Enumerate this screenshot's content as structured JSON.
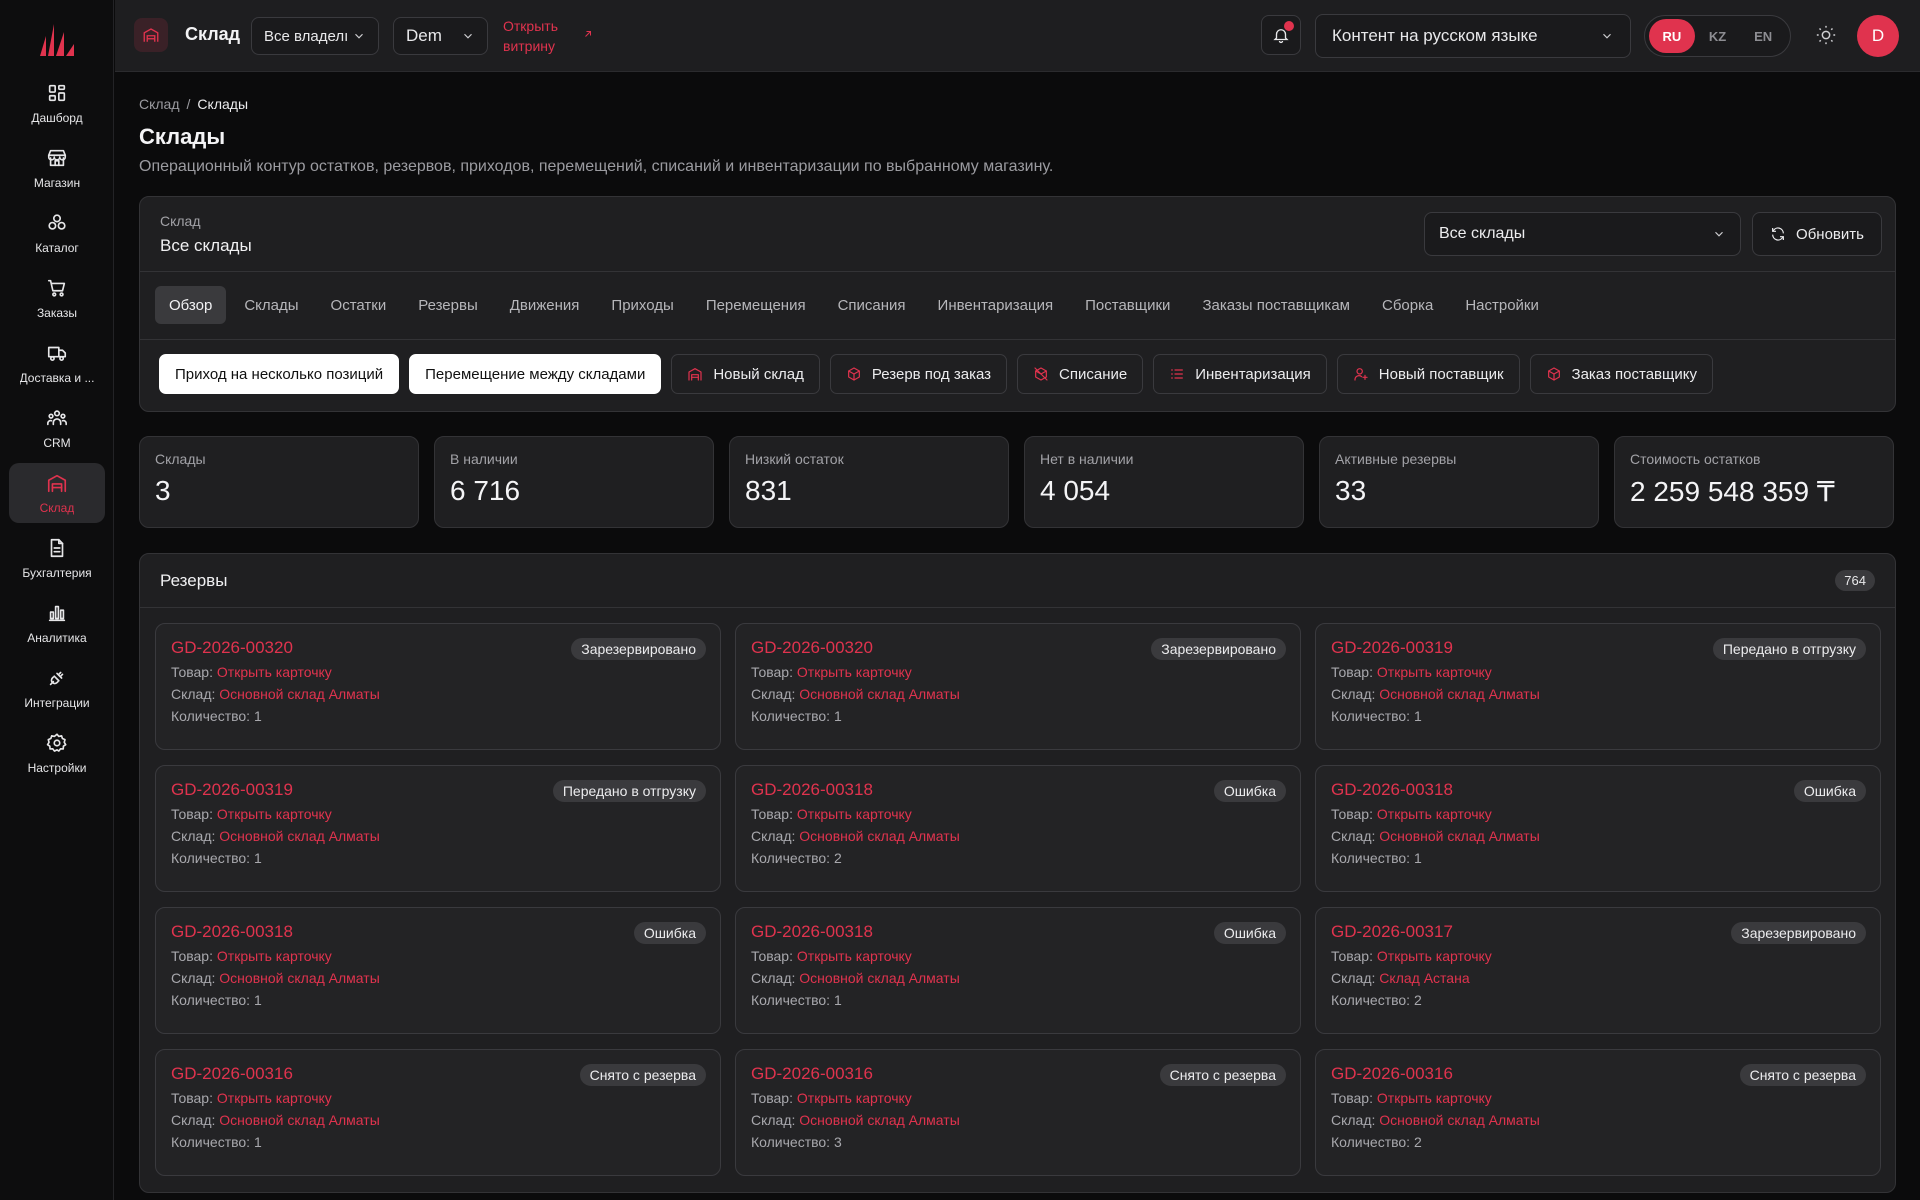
{
  "sidebar": {
    "items": [
      {
        "label": "Дашборд",
        "icon": "dashboard-icon",
        "active": false
      },
      {
        "label": "Магазин",
        "icon": "store-icon",
        "active": false
      },
      {
        "label": "Каталог",
        "icon": "catalog-icon",
        "active": false
      },
      {
        "label": "Заказы",
        "icon": "cart-icon",
        "active": false
      },
      {
        "label": "Доставка и ...",
        "icon": "truck-icon",
        "active": false
      },
      {
        "label": "CRM",
        "icon": "users-icon",
        "active": false
      },
      {
        "label": "Склад",
        "icon": "warehouse-icon",
        "active": true
      },
      {
        "label": "Бухгалтерия",
        "icon": "document-icon",
        "active": false
      },
      {
        "label": "Аналитика",
        "icon": "chart-icon",
        "active": false
      },
      {
        "label": "Интеграции",
        "icon": "plug-icon",
        "active": false
      },
      {
        "label": "Настройки",
        "icon": "gear-icon",
        "active": false
      }
    ]
  },
  "header": {
    "title": "Склад",
    "owner_select": "Все владелı",
    "store_select": "Dem",
    "open_storefront": "Открыть витрину",
    "content_lang_select": "Контент на русском языке",
    "langs": [
      "RU",
      "KZ",
      "EN"
    ],
    "active_lang": "RU",
    "avatar_letter": "D",
    "accent_color": "#e0334e"
  },
  "breadcrumb": {
    "parent": "Склад",
    "separator": "/",
    "current": "Склады"
  },
  "page": {
    "title": "Склады",
    "subtitle": "Операционный контур остатков, резервов, приходов, перемещений, списаний и инвентаризации по выбранному магазину."
  },
  "warehouse_panel": {
    "label": "Склад",
    "value": "Все склады",
    "select_value": "Все склады",
    "refresh_label": "Обновить",
    "tabs": [
      "Обзор",
      "Склады",
      "Остатки",
      "Резервы",
      "Движения",
      "Приходы",
      "Перемещения",
      "Списания",
      "Инвентаризация",
      "Поставщики",
      "Заказы поставщикам",
      "Сборка",
      "Настройки"
    ],
    "active_tab": "Обзор",
    "actions": [
      {
        "label": "Приход на несколько позиций",
        "primary": true,
        "icon": ""
      },
      {
        "label": "Перемещение между складами",
        "primary": true,
        "icon": ""
      },
      {
        "label": "Новый склад",
        "primary": false,
        "icon": "warehouse-icon"
      },
      {
        "label": "Резерв под заказ",
        "primary": false,
        "icon": "box-icon"
      },
      {
        "label": "Списание",
        "primary": false,
        "icon": "box-off-icon"
      },
      {
        "label": "Инвентаризация",
        "primary": false,
        "icon": "list-icon"
      },
      {
        "label": "Новый поставщик",
        "primary": false,
        "icon": "user-plus-icon"
      },
      {
        "label": "Заказ поставщику",
        "primary": false,
        "icon": "box-icon"
      }
    ]
  },
  "stats": [
    {
      "label": "Склады",
      "value": "3"
    },
    {
      "label": "В наличии",
      "value": "6 716"
    },
    {
      "label": "Низкий остаток",
      "value": "831"
    },
    {
      "label": "Нет в наличии",
      "value": "4 054"
    },
    {
      "label": "Активные резервы",
      "value": "33"
    },
    {
      "label": "Стоимость остатков",
      "value": "2 259 548 359 ₸"
    }
  ],
  "reserves": {
    "title": "Резервы",
    "count": "764",
    "product_prefix": "Товар:",
    "warehouse_prefix": "Склад:",
    "qty_prefix": "Количество:",
    "items": [
      {
        "id": "GD-2026-00320",
        "status": "Зарезервировано",
        "product": "Открыть карточку",
        "warehouse": "Основной склад Алматы",
        "qty": "1"
      },
      {
        "id": "GD-2026-00320",
        "status": "Зарезервировано",
        "product": "Открыть карточку",
        "warehouse": "Основной склад Алматы",
        "qty": "1"
      },
      {
        "id": "GD-2026-00319",
        "status": "Передано в отгрузку",
        "product": "Открыть карточку",
        "warehouse": "Основной склад Алматы",
        "qty": "1"
      },
      {
        "id": "GD-2026-00319",
        "status": "Передано в отгрузку",
        "product": "Открыть карточку",
        "warehouse": "Основной склад Алматы",
        "qty": "1"
      },
      {
        "id": "GD-2026-00318",
        "status": "Ошибка",
        "product": "Открыть карточку",
        "warehouse": "Основной склад Алматы",
        "qty": "2"
      },
      {
        "id": "GD-2026-00318",
        "status": "Ошибка",
        "product": "Открыть карточку",
        "warehouse": "Основной склад Алматы",
        "qty": "1"
      },
      {
        "id": "GD-2026-00318",
        "status": "Ошибка",
        "product": "Открыть карточку",
        "warehouse": "Основной склад Алматы",
        "qty": "1"
      },
      {
        "id": "GD-2026-00318",
        "status": "Ошибка",
        "product": "Открыть карточку",
        "warehouse": "Основной склад Алматы",
        "qty": "1"
      },
      {
        "id": "GD-2026-00317",
        "status": "Зарезервировано",
        "product": "Открыть карточку",
        "warehouse": "Склад Астана",
        "qty": "2"
      },
      {
        "id": "GD-2026-00316",
        "status": "Снято с резерва",
        "product": "Открыть карточку",
        "warehouse": "Основной склад Алматы",
        "qty": "1"
      },
      {
        "id": "GD-2026-00316",
        "status": "Снято с резерва",
        "product": "Открыть карточку",
        "warehouse": "Основной склад Алматы",
        "qty": "3"
      },
      {
        "id": "GD-2026-00316",
        "status": "Снято с резерва",
        "product": "Открыть карточку",
        "warehouse": "Основной склад Алматы",
        "qty": "2"
      }
    ]
  }
}
